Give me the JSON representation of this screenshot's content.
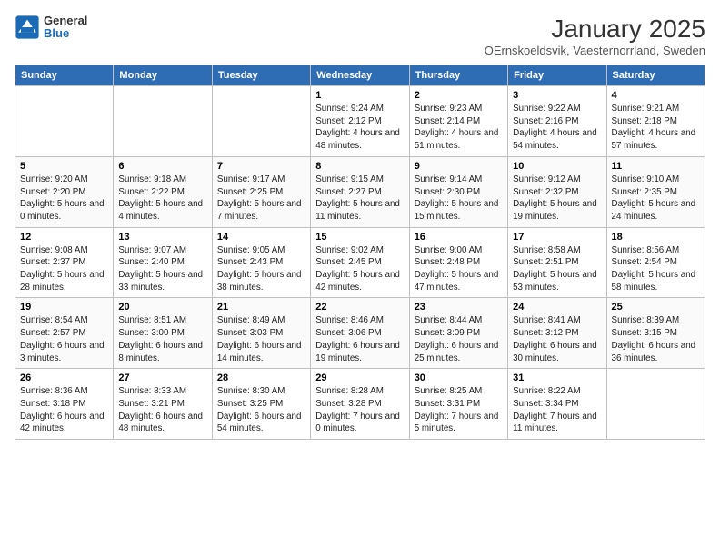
{
  "header": {
    "logo": {
      "general": "General",
      "blue": "Blue"
    },
    "title": "January 2025",
    "location": "OErnskoeldsvik, Vaesternorrland, Sweden"
  },
  "calendar": {
    "headers": [
      "Sunday",
      "Monday",
      "Tuesday",
      "Wednesday",
      "Thursday",
      "Friday",
      "Saturday"
    ],
    "rows": [
      {
        "cells": [
          {
            "day": "",
            "text": ""
          },
          {
            "day": "",
            "text": ""
          },
          {
            "day": "",
            "text": ""
          },
          {
            "day": "1",
            "text": "Sunrise: 9:24 AM\nSunset: 2:12 PM\nDaylight: 4 hours and 48 minutes."
          },
          {
            "day": "2",
            "text": "Sunrise: 9:23 AM\nSunset: 2:14 PM\nDaylight: 4 hours and 51 minutes."
          },
          {
            "day": "3",
            "text": "Sunrise: 9:22 AM\nSunset: 2:16 PM\nDaylight: 4 hours and 54 minutes."
          },
          {
            "day": "4",
            "text": "Sunrise: 9:21 AM\nSunset: 2:18 PM\nDaylight: 4 hours and 57 minutes."
          }
        ]
      },
      {
        "cells": [
          {
            "day": "5",
            "text": "Sunrise: 9:20 AM\nSunset: 2:20 PM\nDaylight: 5 hours and 0 minutes."
          },
          {
            "day": "6",
            "text": "Sunrise: 9:18 AM\nSunset: 2:22 PM\nDaylight: 5 hours and 4 minutes."
          },
          {
            "day": "7",
            "text": "Sunrise: 9:17 AM\nSunset: 2:25 PM\nDaylight: 5 hours and 7 minutes."
          },
          {
            "day": "8",
            "text": "Sunrise: 9:15 AM\nSunset: 2:27 PM\nDaylight: 5 hours and 11 minutes."
          },
          {
            "day": "9",
            "text": "Sunrise: 9:14 AM\nSunset: 2:30 PM\nDaylight: 5 hours and 15 minutes."
          },
          {
            "day": "10",
            "text": "Sunrise: 9:12 AM\nSunset: 2:32 PM\nDaylight: 5 hours and 19 minutes."
          },
          {
            "day": "11",
            "text": "Sunrise: 9:10 AM\nSunset: 2:35 PM\nDaylight: 5 hours and 24 minutes."
          }
        ]
      },
      {
        "cells": [
          {
            "day": "12",
            "text": "Sunrise: 9:08 AM\nSunset: 2:37 PM\nDaylight: 5 hours and 28 minutes."
          },
          {
            "day": "13",
            "text": "Sunrise: 9:07 AM\nSunset: 2:40 PM\nDaylight: 5 hours and 33 minutes."
          },
          {
            "day": "14",
            "text": "Sunrise: 9:05 AM\nSunset: 2:43 PM\nDaylight: 5 hours and 38 minutes."
          },
          {
            "day": "15",
            "text": "Sunrise: 9:02 AM\nSunset: 2:45 PM\nDaylight: 5 hours and 42 minutes."
          },
          {
            "day": "16",
            "text": "Sunrise: 9:00 AM\nSunset: 2:48 PM\nDaylight: 5 hours and 47 minutes."
          },
          {
            "day": "17",
            "text": "Sunrise: 8:58 AM\nSunset: 2:51 PM\nDaylight: 5 hours and 53 minutes."
          },
          {
            "day": "18",
            "text": "Sunrise: 8:56 AM\nSunset: 2:54 PM\nDaylight: 5 hours and 58 minutes."
          }
        ]
      },
      {
        "cells": [
          {
            "day": "19",
            "text": "Sunrise: 8:54 AM\nSunset: 2:57 PM\nDaylight: 6 hours and 3 minutes."
          },
          {
            "day": "20",
            "text": "Sunrise: 8:51 AM\nSunset: 3:00 PM\nDaylight: 6 hours and 8 minutes."
          },
          {
            "day": "21",
            "text": "Sunrise: 8:49 AM\nSunset: 3:03 PM\nDaylight: 6 hours and 14 minutes."
          },
          {
            "day": "22",
            "text": "Sunrise: 8:46 AM\nSunset: 3:06 PM\nDaylight: 6 hours and 19 minutes."
          },
          {
            "day": "23",
            "text": "Sunrise: 8:44 AM\nSunset: 3:09 PM\nDaylight: 6 hours and 25 minutes."
          },
          {
            "day": "24",
            "text": "Sunrise: 8:41 AM\nSunset: 3:12 PM\nDaylight: 6 hours and 30 minutes."
          },
          {
            "day": "25",
            "text": "Sunrise: 8:39 AM\nSunset: 3:15 PM\nDaylight: 6 hours and 36 minutes."
          }
        ]
      },
      {
        "cells": [
          {
            "day": "26",
            "text": "Sunrise: 8:36 AM\nSunset: 3:18 PM\nDaylight: 6 hours and 42 minutes."
          },
          {
            "day": "27",
            "text": "Sunrise: 8:33 AM\nSunset: 3:21 PM\nDaylight: 6 hours and 48 minutes."
          },
          {
            "day": "28",
            "text": "Sunrise: 8:30 AM\nSunset: 3:25 PM\nDaylight: 6 hours and 54 minutes."
          },
          {
            "day": "29",
            "text": "Sunrise: 8:28 AM\nSunset: 3:28 PM\nDaylight: 7 hours and 0 minutes."
          },
          {
            "day": "30",
            "text": "Sunrise: 8:25 AM\nSunset: 3:31 PM\nDaylight: 7 hours and 5 minutes."
          },
          {
            "day": "31",
            "text": "Sunrise: 8:22 AM\nSunset: 3:34 PM\nDaylight: 7 hours and 11 minutes."
          },
          {
            "day": "",
            "text": ""
          }
        ]
      }
    ]
  }
}
